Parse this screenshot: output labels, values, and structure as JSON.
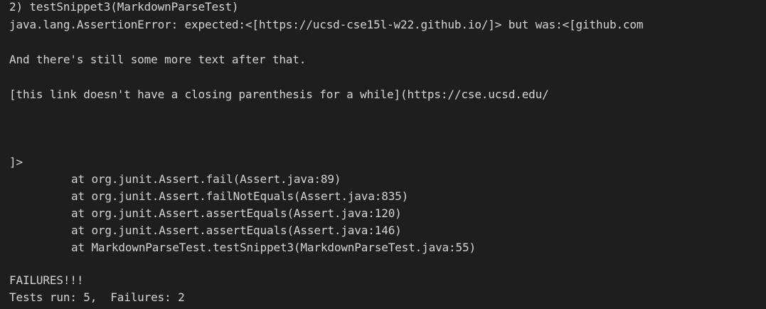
{
  "terminal": {
    "lines": [
      "2) testSnippet3(MarkdownParseTest)",
      "java.lang.AssertionError: expected:<[https://ucsd-cse15l-w22.github.io/]> but was:<[github.com",
      "",
      "And there's still some more text after that.",
      "",
      "[this link doesn't have a closing parenthesis for a while](https://cse.ucsd.edu/",
      "",
      "",
      "",
      "]>",
      "at org.junit.Assert.fail(Assert.java:89)",
      "at org.junit.Assert.failNotEquals(Assert.java:835)",
      "at org.junit.Assert.assertEquals(Assert.java:120)",
      "at org.junit.Assert.assertEquals(Assert.java:146)",
      "at MarkdownParseTest.testSnippet3(MarkdownParseTest.java:55)",
      "",
      "FAILURES!!!",
      "Tests run: 5,  Failures: 2"
    ]
  }
}
